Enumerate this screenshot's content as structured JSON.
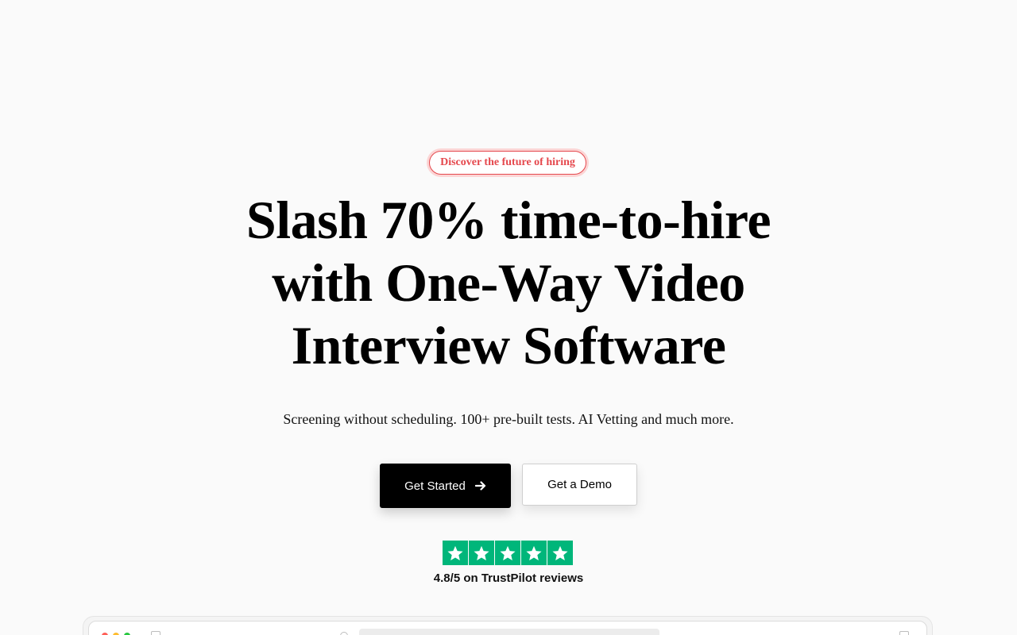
{
  "hero": {
    "badge": "Discover the future of hiring",
    "headline": "Slash 70% time-to-hire with One-Way Video Interview Software",
    "subtitle": "Screening without scheduling. 100+ pre-built tests. AI Vetting and much more.",
    "primary_button": "Get Started",
    "secondary_button": "Get a Demo"
  },
  "rating": {
    "stars": 5,
    "text": "4.8/5 on TrustPilot reviews"
  },
  "colors": {
    "accent": "#e5484d",
    "trustpilot_green": "#00b67a",
    "primary_button_bg": "#000000",
    "background": "#fafafa"
  }
}
